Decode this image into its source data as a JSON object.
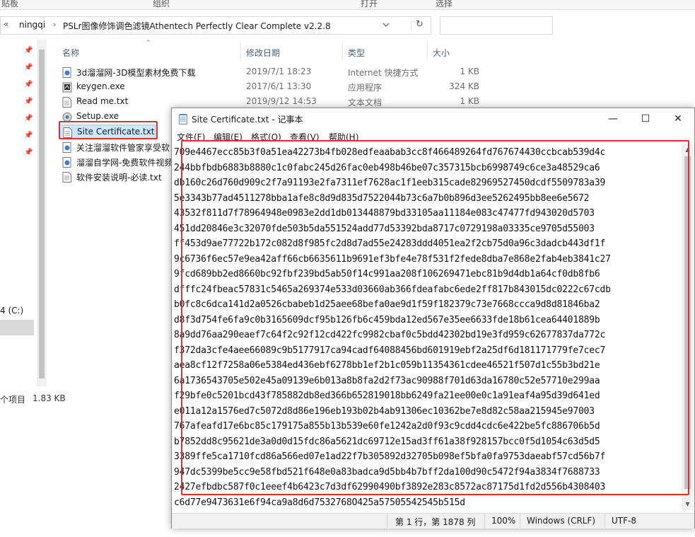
{
  "ribbon": {
    "groups": [
      "贴板",
      "组织",
      "打开",
      "选择"
    ]
  },
  "address": {
    "crumbs": [
      "ningqi",
      "PSLr图像修饰调色滤镜Athentech Perfectly Clear Complete v2.2.8"
    ]
  },
  "columns": {
    "name": "名称",
    "date": "修改日期",
    "type": "类型",
    "size": "大小"
  },
  "files": [
    {
      "name": "3d溜溜网-3D模型素材免费下载",
      "date": "2019/7/1 18:23",
      "type": "Internet 快捷方式",
      "size": "1 KB",
      "icon": "internet-shortcut-icon"
    },
    {
      "name": "keygen.exe",
      "date": "2017/6/1 13:30",
      "type": "应用程序",
      "size": "324 KB",
      "icon": "exe-icon"
    },
    {
      "name": "Read me.txt",
      "date": "2019/9/12 14:53",
      "type": "文本文档",
      "size": "1 KB",
      "icon": "text-file-icon"
    },
    {
      "name": "Setup.exe",
      "date": "",
      "type": "",
      "size": "",
      "icon": "setup-icon"
    },
    {
      "name": "Site Certificate.txt",
      "date": "",
      "type": "",
      "size": "",
      "icon": "text-file-icon"
    },
    {
      "name": "关注溜溜软件管家享受软",
      "date": "",
      "type": "",
      "size": "",
      "icon": "internet-shortcut-icon"
    },
    {
      "name": "溜溜自学网-免费软件视频",
      "date": "",
      "type": "",
      "size": "",
      "icon": "internet-shortcut-icon"
    },
    {
      "name": "软件安装说明-必读.txt",
      "date": "",
      "type": "",
      "size": "",
      "icon": "text-file-icon"
    }
  ],
  "nav": {
    "drive": "4 (C:)"
  },
  "status": {
    "count": "个项目",
    "size": "1.83 KB"
  },
  "notepad": {
    "title": "Site Certificate.txt - 记事本",
    "menu": [
      "文件(F)",
      "编辑(E)",
      "格式(O)",
      "查看(V)",
      "帮助(H)"
    ],
    "lines": [
      "709e4467ecc85b3f0a51ea42273b4fb028edfeaabab3cc8f466489264fd767674430ccbcab539d4c",
      "244bbfbdb6883b8880c1c0fabc245d26fac0eb498b46be07c357315bcb6998749c6ce3a48529ca6",
      "db160c26d760d909c2f7a91193e2fa7311ef7628ac1f1eeb315cade82969527450dcdf5509783a39",
      "5e3343b77ad4511278bba1afe8c8d9d835d7522044b73c6a7b0b896d3ee5262495bb8ee6e5672",
      "43532f811d7f78964948e0983e2dd1db013448879bd33105aa11184e083c47477fd943020d5703",
      "451dd20846e3c32070fde503b5da551524add77d53392bda8717c0729198a03335ce9705d55003",
      "ff453d9ae77722b172c082d8f985fc2d8d7ad55e24283ddd4051ea2f2cb75d0a96c3dadcb443df1f",
      "9c6736f6ec57e9ea42aff66cb6635611b9691ef3bfe4e78f531f2fede8dba7e868e2fab4eb3841c27",
      "9fcd689bb2ed8660bc92fbf239bd5ab50f14c991aa208f106269471ebc81b9d4db1a64cf0db8fb6",
      "dfffc24fbeac57831c5465a269374e533d03660ab366fdeafabc6ede2ff817b843015dc0222c67cdb",
      "b0fc8c6dca141d2a0526cbabeb1d25aee68befa0ae9d1f59f182379c73e7668ccca9d8d81846ba2",
      "d8f3d754fe6fa9c0b3165609dcf95b126fb6c459bda12ed567e35ee6633fde18b61cea64401889b",
      "8a9dd76aa290eaef7c64f2c92f12cd422fc9982cbaf0c5bdd42302bd19e3fd959c62677837da772c",
      "f372da3cfe4aee66089c9b5177917ca94cadf64088456bd601919ebf2a25df6d181171779fe7cec7",
      "aea8cf12f7258a06e5384ed436ebf6278bb1ef2b1c059b11354361cdee46521f507d1c55b3bd21e",
      "6a1736543705e502e45a09139e6b013a8b8fa2d2f73ac90988f701d63da16780c52e57710e299aa",
      "f29bfe0c5201bcd43f785882db8ed366b652819018bb6249fa21ee00e0c1a91eaf4a95d39d641ed",
      "e011a12a1576ed7c5072d8d86e196eb193b02b4ab91306ec10362be7e8d82c58aa215945e97003",
      "767afeafd17e6bc85c179175a855b13b539e60fe1242a2d0f93c9cdd4cdc6e422be5fc886706b5d",
      "b7852dd8c95621de3a0d0d15fdc86a5621dc69712e15ad3ff61a38f928157bcc0f5d1054c63d5d5",
      "3389ffe5ca1710fcd86a566ed07e1ad22f7b305892d32705b098ef5bfa0fa9753daeabf57cd56b7f",
      "947dc5399be5cc9e58fbd521f648e0a83badca9d5bb4b7bff2da100d90c5472f94a3834f7688733",
      "2427efbdbc587f0c1eeef4b6423c7d3df62990490bf3892e283c8572ac87175d1fd2d556b4308403",
      "c6d77e9473631e6f94ca9a8d6d7532768O425a57505542545b515d"
    ],
    "status": {
      "position": "第 1 行，第 1878 列",
      "zoom": "100%",
      "line_ending": "Windows (CRLF)",
      "encoding": "UTF-8"
    },
    "buttons": {
      "minimize": "—",
      "maximize": "☐",
      "close": "✕"
    }
  },
  "colors": {
    "highlight_red": "#e0302b",
    "selection_blue": "#cce8ff"
  }
}
